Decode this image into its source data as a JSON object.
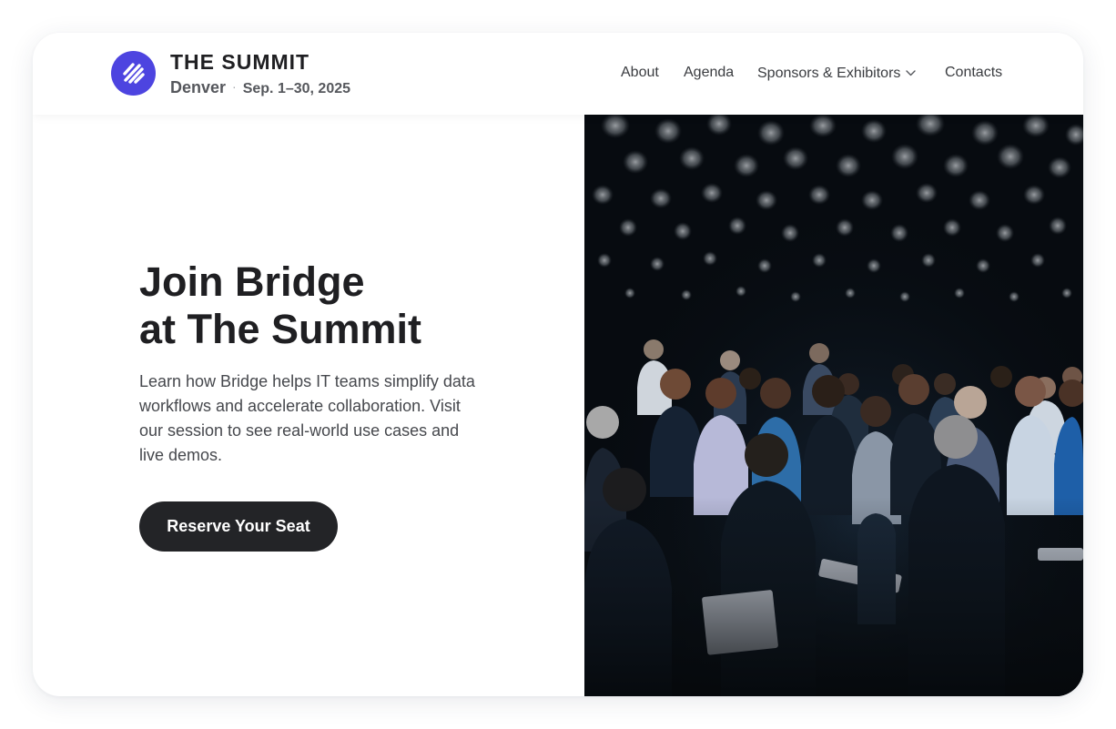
{
  "header": {
    "title": "THE SUMMIT",
    "city": "Denver",
    "separator": "·",
    "dates": "Sep. 1–30, 2025",
    "logo_icon": "striped-circle-logo-icon"
  },
  "nav": {
    "items": [
      {
        "label": "About"
      },
      {
        "label": "Agenda"
      },
      {
        "label": "Sponsors & Exhibitors",
        "has_dropdown": true
      },
      {
        "label": "Contacts"
      }
    ]
  },
  "hero": {
    "headline_line1": "Join Bridge",
    "headline_line2": "at The Summit",
    "description": "Learn how Bridge helps IT teams simplify data workflows and accelerate collaboration. Visit our session to see real-world use cases and live demos.",
    "cta_label": "Reserve Your Seat",
    "photo": "conference-audience-photo"
  },
  "colors": {
    "brand": "#4d44e0",
    "cta_bg": "#232427",
    "text_primary": "#1f1f22",
    "text_secondary": "#46484d"
  }
}
